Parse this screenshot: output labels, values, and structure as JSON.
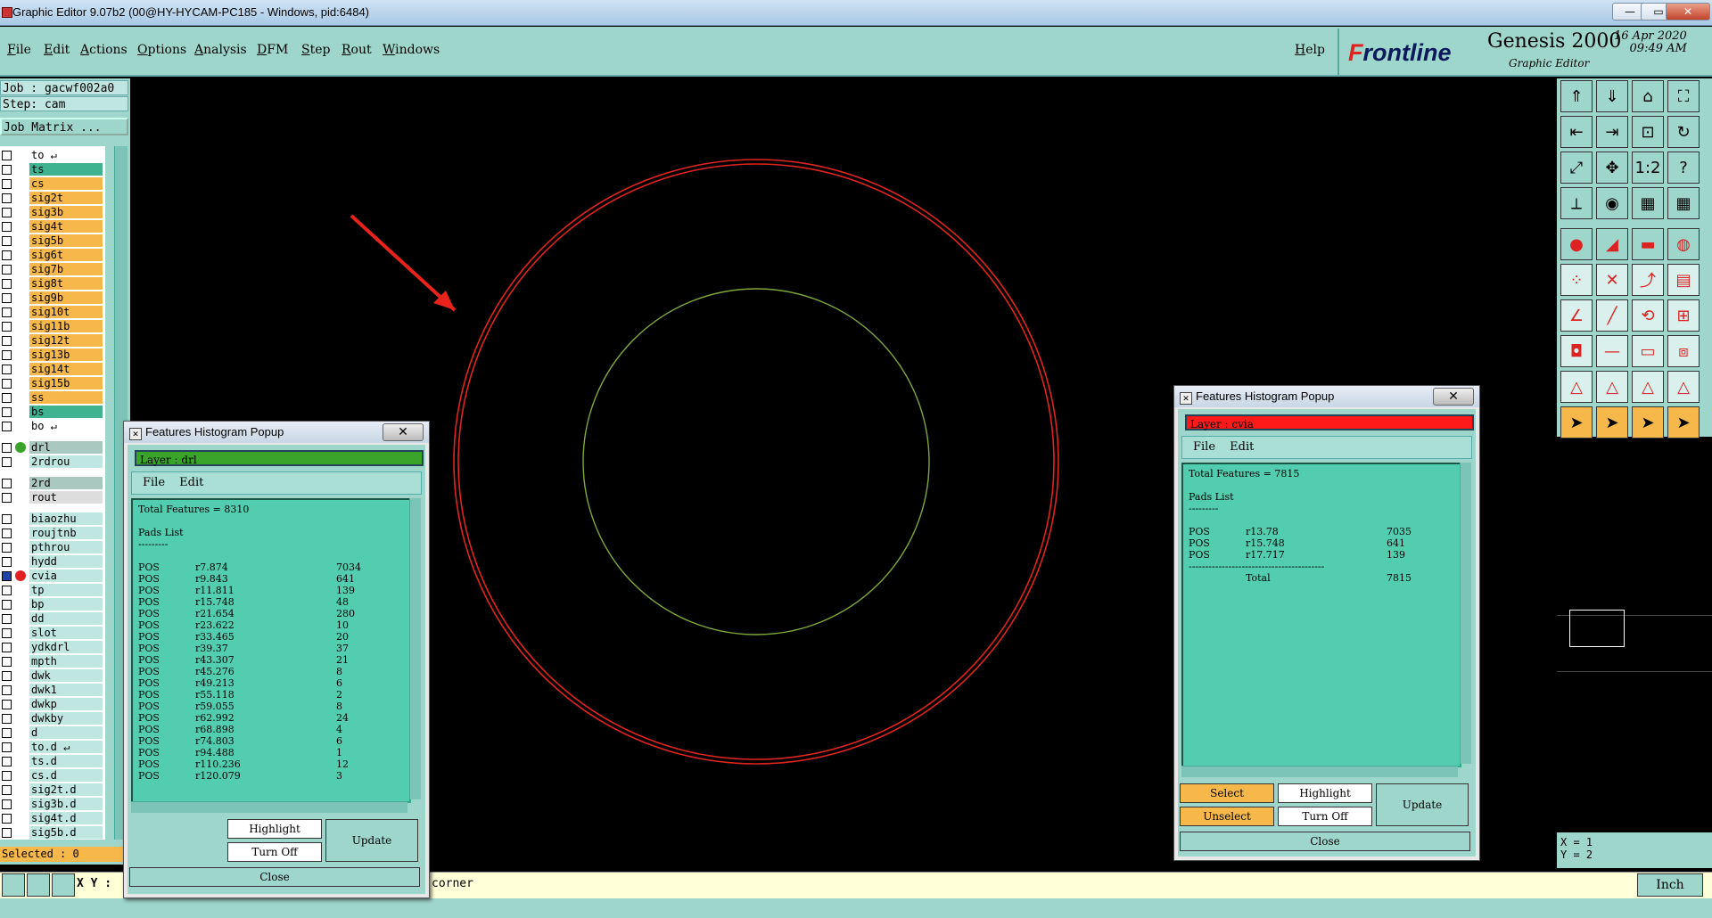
{
  "window": {
    "title": "Graphic Editor 9.07b2 (00@HY-HYCAM-PC185 - Windows, pid:6484)",
    "minimize": "—",
    "restore": "▭",
    "close": "✕"
  },
  "menubar": {
    "items": [
      "File",
      "Edit",
      "Actions",
      "Options",
      "Analysis",
      "DFM",
      "Step",
      "Rout",
      "Windows"
    ],
    "help": "Help"
  },
  "branding": {
    "logo_prefix": "F",
    "logo_rest": "rontline",
    "product": "Genesis 2000",
    "subtitle": "Graphic Editor",
    "date": "16 Apr 2020",
    "time": "09:49 AM"
  },
  "left_panel": {
    "job": "Job : gacwf002a0",
    "step": "Step: cam",
    "job_matrix": "Job Matrix ...",
    "selected": "Selected : 0",
    "layers": [
      {
        "name": "to",
        "color": "#ffffff",
        "arrow": "↵"
      },
      {
        "name": "ts",
        "color": "#3fb38f"
      },
      {
        "name": "cs",
        "color": "#f6b84a"
      },
      {
        "name": "sig2t",
        "color": "#f6b84a"
      },
      {
        "name": "sig3b",
        "color": "#f6b84a"
      },
      {
        "name": "sig4t",
        "color": "#f6b84a"
      },
      {
        "name": "sig5b",
        "color": "#f6b84a"
      },
      {
        "name": "sig6t",
        "color": "#f6b84a"
      },
      {
        "name": "sig7b",
        "color": "#f6b84a"
      },
      {
        "name": "sig8t",
        "color": "#f6b84a"
      },
      {
        "name": "sig9b",
        "color": "#f6b84a"
      },
      {
        "name": "sig10t",
        "color": "#f6b84a"
      },
      {
        "name": "sig11b",
        "color": "#f6b84a"
      },
      {
        "name": "sig12t",
        "color": "#f6b84a"
      },
      {
        "name": "sig13b",
        "color": "#f6b84a"
      },
      {
        "name": "sig14t",
        "color": "#f6b84a"
      },
      {
        "name": "sig15b",
        "color": "#f6b84a"
      },
      {
        "name": "ss",
        "color": "#f6b84a"
      },
      {
        "name": "bs",
        "color": "#3fb38f"
      },
      {
        "name": "bo",
        "color": "#ffffff",
        "arrow": "↵"
      },
      {
        "name": "drl",
        "color": "#a9c9c0",
        "dot": "#3aa32a"
      },
      {
        "name": "2rdrou",
        "color": "#bfe6e0"
      },
      {
        "name": "2rd",
        "color": "#a9c9c0"
      },
      {
        "name": "rout",
        "color": "#dddddd"
      },
      {
        "name": "biaozhu",
        "color": "#bfe6e0"
      },
      {
        "name": "roujtnb",
        "color": "#bfe6e0"
      },
      {
        "name": "pthrou",
        "color": "#bfe6e0"
      },
      {
        "name": "hydd",
        "color": "#bfe6e0"
      },
      {
        "name": "cvia",
        "color": "#bfe6e0",
        "dot": "#e22020",
        "active": true
      },
      {
        "name": "tp",
        "color": "#bfe6e0"
      },
      {
        "name": "bp",
        "color": "#bfe6e0"
      },
      {
        "name": "dd",
        "color": "#bfe6e0"
      },
      {
        "name": "slot",
        "color": "#bfe6e0"
      },
      {
        "name": "ydkdrl",
        "color": "#bfe6e0"
      },
      {
        "name": "mpth",
        "color": "#bfe6e0"
      },
      {
        "name": "dwk",
        "color": "#bfe6e0"
      },
      {
        "name": "dwk1",
        "color": "#bfe6e0"
      },
      {
        "name": "dwkp",
        "color": "#bfe6e0"
      },
      {
        "name": "dwkby",
        "color": "#bfe6e0"
      },
      {
        "name": "d",
        "color": "#bfe6e0"
      },
      {
        "name": "to.d",
        "color": "#bfe6e0",
        "arrow": "↵"
      },
      {
        "name": "ts.d",
        "color": "#bfe6e0"
      },
      {
        "name": "cs.d",
        "color": "#bfe6e0"
      },
      {
        "name": "sig2t.d",
        "color": "#bfe6e0"
      },
      {
        "name": "sig3b.d",
        "color": "#bfe6e0"
      },
      {
        "name": "sig4t.d",
        "color": "#bfe6e0"
      },
      {
        "name": "sig5b.d",
        "color": "#bfe6e0"
      }
    ]
  },
  "status_bar": {
    "xy_label": "X Y :",
    "prompt": "corner",
    "units": "Inch"
  },
  "coords": {
    "x_label": "X = 1",
    "y_label": "Y = 2"
  },
  "colors": {
    "panel": "#9ed6cc",
    "canvas": "#000000",
    "outer_circle": "#e0241e",
    "inner_circle": "#7fa83c",
    "arrow": "#e8231b",
    "drl_header": "#3aa32a",
    "cvia_header": "#ff1a1a",
    "text_area": "#52cdb0",
    "orange_btn": "#f6b84a"
  },
  "popup_left": {
    "title": "Features Histogram Popup",
    "layer": "Layer :  drl",
    "menu_file": "File",
    "menu_edit": "Edit",
    "total": "Total Features = 8310",
    "section": "Pads List",
    "underline": "---------",
    "rows": [
      [
        "POS",
        "r7.874",
        "7034"
      ],
      [
        "POS",
        "r9.843",
        "641"
      ],
      [
        "POS",
        "r11.811",
        "139"
      ],
      [
        "POS",
        "r15.748",
        "48"
      ],
      [
        "POS",
        "r21.654",
        "280"
      ],
      [
        "POS",
        "r23.622",
        "10"
      ],
      [
        "POS",
        "r33.465",
        "20"
      ],
      [
        "POS",
        "r39.37",
        "37"
      ],
      [
        "POS",
        "r43.307",
        "21"
      ],
      [
        "POS",
        "r45.276",
        "8"
      ],
      [
        "POS",
        "r49.213",
        "6"
      ],
      [
        "POS",
        "r55.118",
        "2"
      ],
      [
        "POS",
        "r59.055",
        "8"
      ],
      [
        "POS",
        "r62.992",
        "24"
      ],
      [
        "POS",
        "r68.898",
        "4"
      ],
      [
        "POS",
        "r74.803",
        "6"
      ],
      [
        "POS",
        "r94.488",
        "1"
      ],
      [
        "POS",
        "r110.236",
        "12"
      ],
      [
        "POS",
        "r120.079",
        "3"
      ]
    ],
    "highlight": "Highlight",
    "turn_off": "Turn Off",
    "update": "Update",
    "close": "Close"
  },
  "popup_right": {
    "title": "Features Histogram Popup",
    "layer": "Layer :  cvia",
    "menu_file": "File",
    "menu_edit": "Edit",
    "total": "Total Features = 7815",
    "section": "Pads List",
    "underline": "---------",
    "rows": [
      [
        "POS",
        "r13.78",
        "7035"
      ],
      [
        "POS",
        "r15.748",
        "641"
      ],
      [
        "POS",
        "r17.717",
        "139"
      ]
    ],
    "separator": "-----------------------------------------",
    "total_label": "Total",
    "total_value": "7815",
    "select": "Select",
    "unselect": "Unselect",
    "highlight": "Highlight",
    "turn_off": "Turn Off",
    "update": "Update",
    "close": "Close"
  },
  "toolbar_icons": [
    "page-up-icon",
    "page-down-icon",
    "home-icon",
    "fit-screen-icon",
    "pan-left-icon",
    "pan-right-icon",
    "zoom-box-icon",
    "redraw-icon",
    "fit-all-icon",
    "center-icon",
    "one-to-one-icon",
    "help-icon",
    "measure-icon",
    "ruler-icon",
    "layer-grid-icon",
    "layer-grid-2-icon",
    "pad-icon",
    "snap-icon",
    "line-icon",
    "dot-icon",
    "node-icon",
    "cross-icon",
    "connect-icon",
    "step-icon",
    "angle-icon",
    "line-2-icon",
    "arc-icon",
    "feature-icon",
    "symbol-icon",
    "dash-icon",
    "frame-icon",
    "select-box-icon",
    "triangle-icon",
    "triangle-2-icon",
    "triangle-3-icon",
    "triangle-4-icon",
    "pointer-icon",
    "pointer-2-icon",
    "pointer-3-icon",
    "pointer-4-icon"
  ]
}
